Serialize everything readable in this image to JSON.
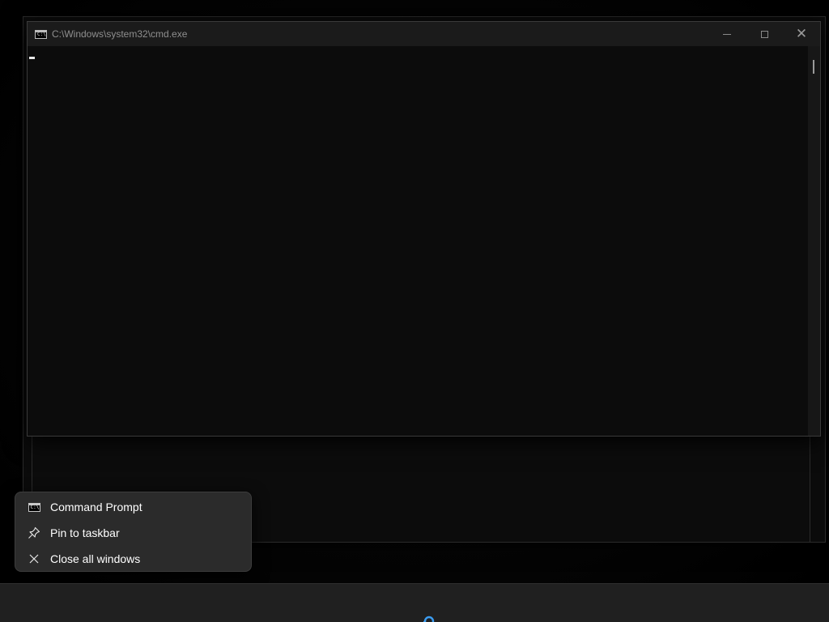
{
  "window": {
    "title": "C:\\Windows\\system32\\cmd.exe",
    "icon": "cmd-icon",
    "controls": {
      "minimize": "minimize-icon",
      "maximize": "maximize-icon",
      "close": "close-icon"
    },
    "console_text": ""
  },
  "jumplist": {
    "items": [
      {
        "label": "Command Prompt",
        "icon": "cmd-icon"
      },
      {
        "label": "Pin to taskbar",
        "icon": "pin-icon"
      },
      {
        "label": "Close all windows",
        "icon": "close-icon"
      }
    ]
  },
  "taskbar": {
    "search_icon": "search-icon",
    "accent": "#3b9cf0"
  },
  "colors": {
    "console_bg": "#0c0c0c",
    "titlebar_bg": "#1b1b1b",
    "menu_bg": "#2b2b2b",
    "taskbar_bg": "#202020"
  }
}
